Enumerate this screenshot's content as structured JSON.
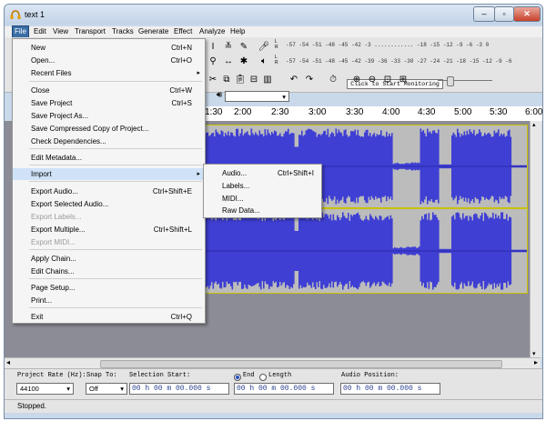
{
  "window": {
    "title": "text 1"
  },
  "menubar": [
    "File",
    "Edit",
    "View",
    "Transport",
    "Tracks",
    "Generate",
    "Effect",
    "Analyze",
    "Help"
  ],
  "meter": {
    "scale": "-57 -54 -51 -48 -45 -42 -3 ............ -18 -15 -12  -9  -6  -3  0",
    "scale2": "-57 -54 -51 -48 -45 -42 -39 -36 -33 -30 -27 -24 -21 -18 -15 -12 -9 -6 -3 0",
    "monitor_button": "Click to Start Monitoring",
    "l": "L",
    "r": "R"
  },
  "ruler": {
    "ticks": [
      "1:30",
      "2:00",
      "2:30",
      "3:00",
      "3:30",
      "4:00",
      "4:30",
      "5:00",
      "5:30",
      "6:00"
    ]
  },
  "file_menu": [
    {
      "label": "New",
      "shortcut": "Ctrl+N",
      "disabled": false
    },
    {
      "label": "Open...",
      "shortcut": "Ctrl+O",
      "disabled": false
    },
    {
      "label": "Recent Files",
      "shortcut": "",
      "submenu": true,
      "disabled": false
    },
    {
      "label": "Close",
      "shortcut": "Ctrl+W",
      "disabled": false
    },
    {
      "label": "Save Project",
      "shortcut": "Ctrl+S",
      "disabled": false
    },
    {
      "label": "Save Project As...",
      "shortcut": "",
      "disabled": false
    },
    {
      "label": "Save Compressed Copy of Project...",
      "shortcut": "",
      "disabled": false
    },
    {
      "label": "Check Dependencies...",
      "shortcut": "",
      "disabled": false
    },
    {
      "label": "Edit Metadata...",
      "shortcut": "",
      "disabled": false
    },
    {
      "label": "Import",
      "shortcut": "",
      "submenu": true,
      "disabled": false
    },
    {
      "label": "Export Audio...",
      "shortcut": "Ctrl+Shift+E",
      "disabled": false
    },
    {
      "label": "Export Selected Audio...",
      "shortcut": "",
      "disabled": false
    },
    {
      "label": "Export Labels...",
      "shortcut": "",
      "disabled": true
    },
    {
      "label": "Export Multiple...",
      "shortcut": "Ctrl+Shift+L",
      "disabled": false
    },
    {
      "label": "Export MIDI...",
      "shortcut": "",
      "disabled": true
    },
    {
      "label": "Apply Chain...",
      "shortcut": "",
      "disabled": false
    },
    {
      "label": "Edit Chains...",
      "shortcut": "",
      "disabled": false
    },
    {
      "label": "Page Setup...",
      "shortcut": "",
      "disabled": false
    },
    {
      "label": "Print...",
      "shortcut": "",
      "disabled": false
    },
    {
      "label": "Exit",
      "shortcut": "Ctrl+Q",
      "disabled": false
    }
  ],
  "import_submenu": [
    {
      "label": "Audio...",
      "shortcut": "Ctrl+Shift+I"
    },
    {
      "label": "Labels...",
      "shortcut": ""
    },
    {
      "label": "MIDI...",
      "shortcut": ""
    },
    {
      "label": "Raw Data...",
      "shortcut": ""
    }
  ],
  "selection_toolbar": {
    "project_rate_label": "Project Rate (Hz):",
    "project_rate_value": "44100",
    "snap_to_label": "Snap To:",
    "snap_to_value": "Off",
    "selection_start_label": "Selection Start:",
    "end_label": "End",
    "length_label": "Length",
    "audio_position_label": "Audio Position:",
    "time_value": "00 h 00 m 00.000 s"
  },
  "status": {
    "text": "Stopped."
  },
  "colors": {
    "waveform": "#3f3fd4",
    "track_bg": "#bcbcbc",
    "selection_border": "#c9c200",
    "menu_highlight": "#cfe2f7"
  }
}
